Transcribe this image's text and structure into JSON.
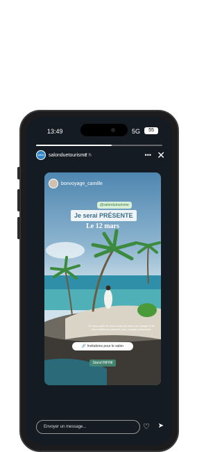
{
  "status_bar": {
    "time": "13:49",
    "network": "5G",
    "battery": "55"
  },
  "story": {
    "account": "salonduetourisme",
    "time_ago": "2 h",
    "avatar_text": "salon",
    "progress": 0.6
  },
  "card": {
    "poster_name": "bonvoyage_camille",
    "mention": "@salondutourisme",
    "headline": "Je serai PRÉSENTE",
    "date": "Le 12 mars",
    "caption": "Je vous parle de mes coups de cœur de voyage et de mes meilleures astuces pour voyager autrement.",
    "cta_label": "Invitations pour le salon",
    "stand": "Stand INFINI"
  },
  "footer": {
    "message_placeholder": "Envoyer un message..."
  },
  "icons": {
    "more": "more-icon",
    "close": "close-icon",
    "heart": "heart-icon",
    "send": "send-icon",
    "link": "link-icon"
  },
  "colors": {
    "phone_frame": "#1c1c1e",
    "screen": "#141b22",
    "headline": "#3d6e88",
    "mention_bg": "#d9efd8",
    "stand_bg": "#468c78"
  }
}
